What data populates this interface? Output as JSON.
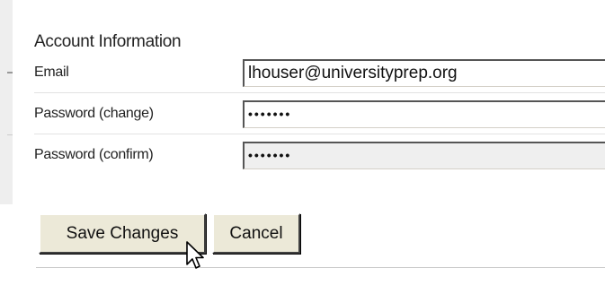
{
  "section": {
    "title": "Account Information"
  },
  "fields": [
    {
      "label": "Email",
      "value": "lhouser@universityprep.org"
    },
    {
      "label": "Password (change)",
      "value": "•••••••"
    },
    {
      "label": "Password (confirm)",
      "value": "•••••••"
    }
  ],
  "buttons": {
    "save_label": "Save Changes",
    "cancel_label": "Cancel"
  },
  "icons": {
    "cursor": "mouse-pointer-icon"
  }
}
